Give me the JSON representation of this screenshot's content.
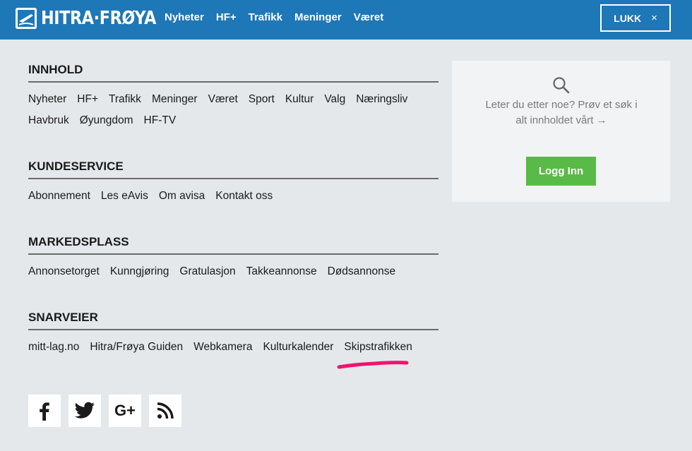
{
  "header": {
    "logo_text": "HITRA·FRØYA",
    "nav": [
      "Nyheter",
      "HF+",
      "Trafikk",
      "Meninger",
      "Været"
    ],
    "close_label": "LUKK",
    "close_glyph": "×",
    "brand_color": "#1e77b6"
  },
  "sections": [
    {
      "title": "INNHOLD",
      "links": [
        "Nyheter",
        "HF+",
        "Trafikk",
        "Meninger",
        "Været",
        "Sport",
        "Kultur",
        "Valg",
        "Næringsliv",
        "Havbruk",
        "Øyungdom",
        "HF-TV"
      ]
    },
    {
      "title": "KUNDESERVICE",
      "links": [
        "Abonnement",
        "Les eAvis",
        "Om avisa",
        "Kontakt oss"
      ]
    },
    {
      "title": "MARKEDSPLASS",
      "links": [
        "Annonsetorget",
        "Kunngjøring",
        "Gratulasjon",
        "Takkeannonse",
        "Dødsannonse"
      ]
    },
    {
      "title": "SNARVEIER",
      "links": [
        "mitt-lag.no",
        "Hitra/Frøya Guiden",
        "Webkamera",
        "Kulturkalender",
        "Skipstrafikken"
      ]
    }
  ],
  "aside": {
    "search_prompt": "Leter du etter noe? Prøv et søk i alt innholdet vårt →",
    "login_label": "Logg Inn",
    "login_color": "#5aba47"
  },
  "highlight": {
    "target": "Skipstrafikken",
    "color": "#f0146e"
  },
  "social": [
    {
      "icon": "facebook-icon",
      "glyph": "f"
    },
    {
      "icon": "twitter-icon",
      "glyph": ""
    },
    {
      "icon": "google-plus-icon",
      "glyph": "G+"
    },
    {
      "icon": "rss-icon",
      "glyph": ""
    }
  ]
}
